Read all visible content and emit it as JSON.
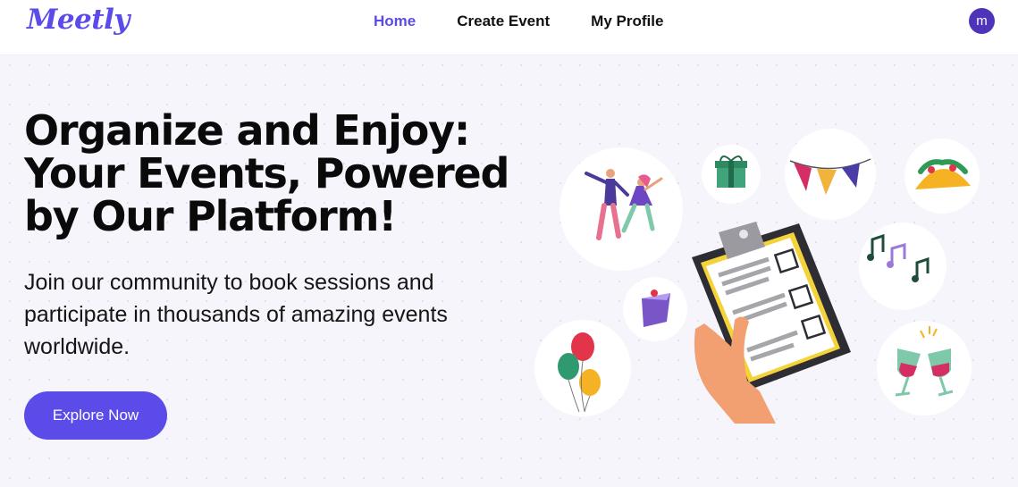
{
  "header": {
    "logo": "Meetly",
    "nav": [
      {
        "label": "Home",
        "active": true
      },
      {
        "label": "Create Event",
        "active": false
      },
      {
        "label": "My Profile",
        "active": false
      }
    ],
    "avatar_letter": "m"
  },
  "hero": {
    "title_lines": [
      "Organize and Enjoy:",
      "Your Events, Powered",
      "by Our Platform!"
    ],
    "subtitle_lines": [
      "Join our community to book sessions and",
      "participate in thousands of amazing events",
      "worldwide."
    ],
    "cta_label": "Explore Now"
  },
  "colors": {
    "brand": "#5b4be8",
    "avatar": "#4e34b8",
    "background": "#f5f5fb"
  },
  "illustration_icons": [
    "dancing-couple-icon",
    "gift-box-icon",
    "bunting-flags-icon",
    "taco-icon",
    "music-notes-icon",
    "cake-slice-icon",
    "balloons-icon",
    "wine-glasses-icon",
    "clipboard-checklist-icon"
  ]
}
